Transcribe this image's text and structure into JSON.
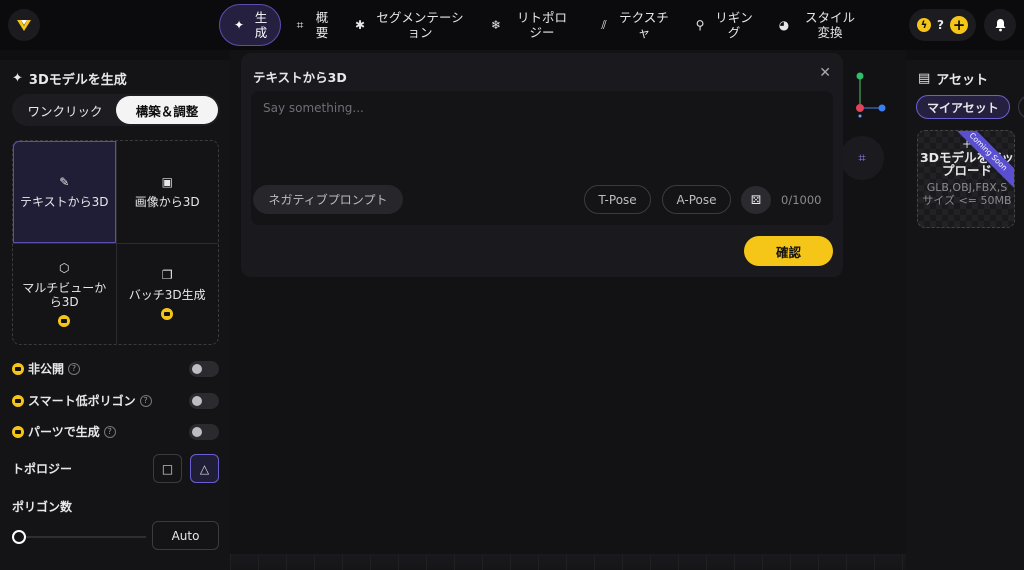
{
  "nav": {
    "items": [
      {
        "label": "生成",
        "icon": "sparkle-icon",
        "active": true
      },
      {
        "label": "概要",
        "icon": "scan-icon",
        "active": false
      },
      {
        "label": "セグメンテーション",
        "icon": "puzzle-icon",
        "active": false
      },
      {
        "label": "リトポロジー",
        "icon": "mesh-icon",
        "active": false
      },
      {
        "label": "テクスチャ",
        "icon": "texture-icon",
        "active": false
      },
      {
        "label": "リギング",
        "icon": "rig-icon",
        "active": false
      },
      {
        "label": "スタイル変換",
        "icon": "palette-icon",
        "active": false
      }
    ],
    "credits_text": "?"
  },
  "left": {
    "title": "3Dモデルを生成",
    "seg": {
      "one_click": "ワンクリック",
      "build": "構築＆調整"
    },
    "modes": {
      "text_to_3d": "テキストから3D",
      "image_to_3d": "画像から3D",
      "multiview_to_3d": "マルチビューから3D",
      "batch_3d": "バッチ3D生成"
    },
    "options": {
      "private": "非公開",
      "smart_low_poly": "スマート低ポリゴン",
      "parts_gen": "パーツで生成"
    },
    "topology_label": "トポロジー",
    "polycount_label": "ポリゴン数",
    "auto_label": "Auto"
  },
  "dialog": {
    "title": "テキストから3D",
    "placeholder": "Say something...",
    "negative_prompt": "ネガティブプロンプト",
    "t_pose": "T-Pose",
    "a_pose": "A-Pose",
    "char_count": "0/1000",
    "confirm": "確認"
  },
  "right": {
    "title": "アセット",
    "my_assets": "マイアセット",
    "upload_title": "3Dモデルをアップロード",
    "upload_sub": "GLB,OBJ,FBX,S サイズ <= 50MB",
    "ribbon": "Coming Soon"
  },
  "colors": {
    "accent": "#5a4fb0",
    "yellow": "#f5c518"
  }
}
